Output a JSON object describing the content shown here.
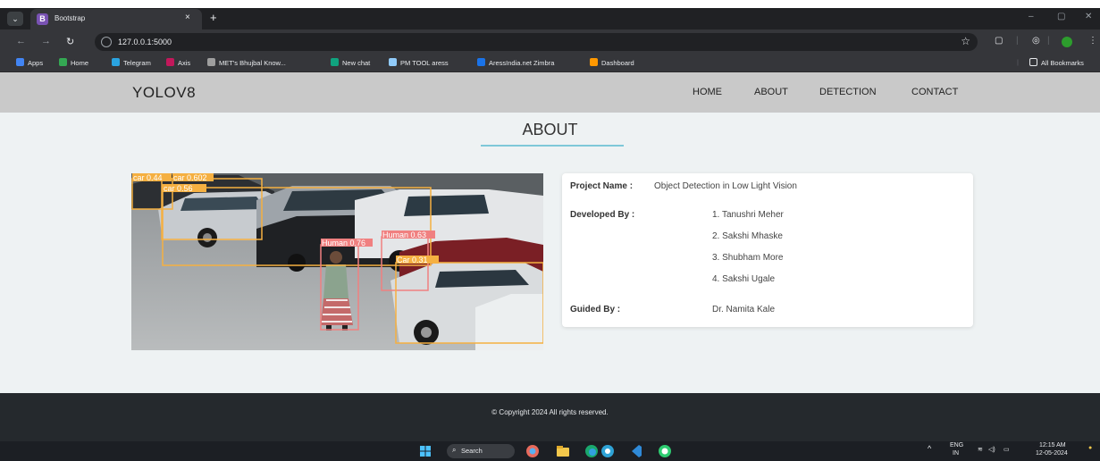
{
  "browser": {
    "tab_title": "Bootstrap",
    "tab_close": "×",
    "new_tab": "+",
    "url": "127.0.0.1:5000",
    "window_controls": [
      "–",
      "▢",
      "✕"
    ],
    "bookmarks": [
      {
        "label": "Apps",
        "color": "#4285f4"
      },
      {
        "label": "Home",
        "color": "#34a853"
      },
      {
        "label": "Telegram",
        "color": "#2aa3e0"
      },
      {
        "label": "Axis",
        "color": "#c2185b"
      },
      {
        "label": "MET's Bhujbal Know...",
        "color": "#9e9e9e"
      },
      {
        "label": "New chat",
        "color": "#10a37f"
      },
      {
        "label": "PM TOOL aress",
        "color": "#90caf9"
      },
      {
        "label": "AressIndia.net Zimbra",
        "color": "#1a73e8"
      },
      {
        "label": "Dashboard",
        "color": "#ff9800"
      }
    ],
    "all_bookmarks": "All Bookmarks"
  },
  "navbar": {
    "brand": "YOLOV8",
    "links": [
      "HOME",
      "ABOUT",
      "DETECTION",
      "CONTACT"
    ]
  },
  "page": {
    "title": "ABOUT",
    "detections": [
      {
        "label": "car 0.44",
        "color": "#f5b041"
      },
      {
        "label": "car 0.602",
        "color": "#f5b041"
      },
      {
        "label": "car 0.56",
        "color": "#f5b041"
      },
      {
        "label": "Human 0.76",
        "color": "#f08080"
      },
      {
        "label": "Human 0.63",
        "color": "#f08080"
      },
      {
        "label": "Car 0.31",
        "color": "#f5b041"
      }
    ]
  },
  "project": {
    "name_label": "Project Name :",
    "name_value": "Object Detection in Low Light Vision",
    "developed_label": "Developed By :",
    "developers": [
      "1. Tanushri Meher",
      "2. Sakshi Mhaske",
      "3. Shubham More",
      "4. Sakshi Ugale"
    ],
    "guided_label": "Guided By :",
    "guide": "Dr. Namita Kale"
  },
  "footer": {
    "copyright": "© Copyright 2024 All rights reserved."
  },
  "taskbar": {
    "search": "Search",
    "lang_top": "ENG",
    "lang_bottom": "IN",
    "time": "12:15 AM",
    "date": "12-05-2024"
  }
}
